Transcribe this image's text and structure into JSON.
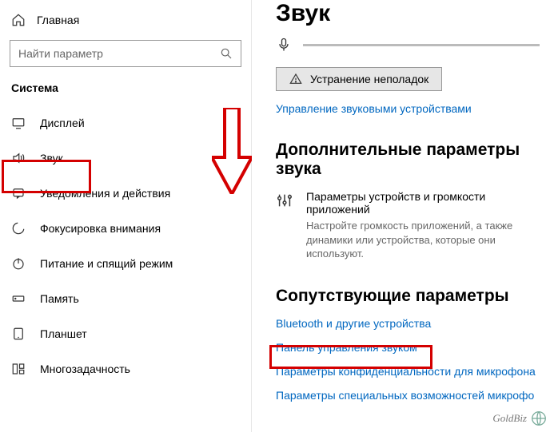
{
  "sidebar": {
    "home": "Главная",
    "search_placeholder": "Найти параметр",
    "heading": "Система",
    "items": [
      {
        "label": "Дисплей",
        "icon": "display-icon"
      },
      {
        "label": "Звук",
        "icon": "sound-icon"
      },
      {
        "label": "Уведомления и действия",
        "icon": "notifications-icon"
      },
      {
        "label": "Фокусировка внимания",
        "icon": "focus-icon"
      },
      {
        "label": "Питание и спящий режим",
        "icon": "power-icon"
      },
      {
        "label": "Память",
        "icon": "storage-icon"
      },
      {
        "label": "Планшет",
        "icon": "tablet-icon"
      },
      {
        "label": "Многозадачность",
        "icon": "multitasking-icon"
      }
    ]
  },
  "main": {
    "title": "Звук",
    "troubleshoot": "Устранение неполадок",
    "manage_devices": "Управление звуковыми устройствами",
    "section_advanced": "Дополнительные параметры звука",
    "app_volume_title": "Параметры устройств и громкости приложений",
    "app_volume_desc": "Настройте громкость приложений, а также динамики или устройства, которые они используют.",
    "section_related": "Сопутствующие параметры",
    "related_links": [
      "Bluetooth и другие устройства",
      "Панель управления звуком",
      "Параметры конфиденциальности для микрофона",
      "Параметры специальных возможностей микрофо"
    ]
  },
  "watermark": "GoldBiz"
}
